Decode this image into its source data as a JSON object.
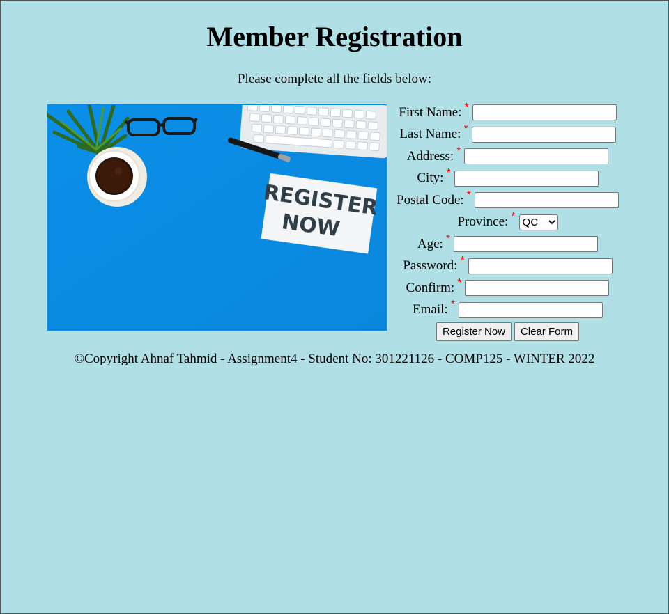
{
  "page": {
    "title": "Member Registration",
    "subtitle": "Please complete all the fields below:"
  },
  "hero_image": {
    "sign_line1": "REGISTER",
    "sign_line2": "NOW"
  },
  "form": {
    "required_marker": "*",
    "fields": {
      "first_name": {
        "label": "First Name:",
        "value": ""
      },
      "last_name": {
        "label": "Last Name:",
        "value": ""
      },
      "address": {
        "label": "Address:",
        "value": ""
      },
      "city": {
        "label": "City:",
        "value": ""
      },
      "postal_code": {
        "label": "Postal Code:",
        "value": ""
      },
      "province": {
        "label": "Province:",
        "selected": "QC"
      },
      "age": {
        "label": "Age:",
        "value": ""
      },
      "password": {
        "label": "Password:",
        "value": ""
      },
      "confirm": {
        "label": "Confirm:",
        "value": ""
      },
      "email": {
        "label": "Email:",
        "value": ""
      }
    },
    "buttons": {
      "register": "Register Now",
      "clear": "Clear Form"
    }
  },
  "footer": {
    "text": "©Copyright Ahnaf Tahmid - Assignment4 - Student No: 301221126 - COMP125 - WINTER 2022"
  },
  "colors": {
    "background": "#b0dfe5",
    "required": "#ff0000",
    "hero_blue": "#0a8fe6"
  }
}
